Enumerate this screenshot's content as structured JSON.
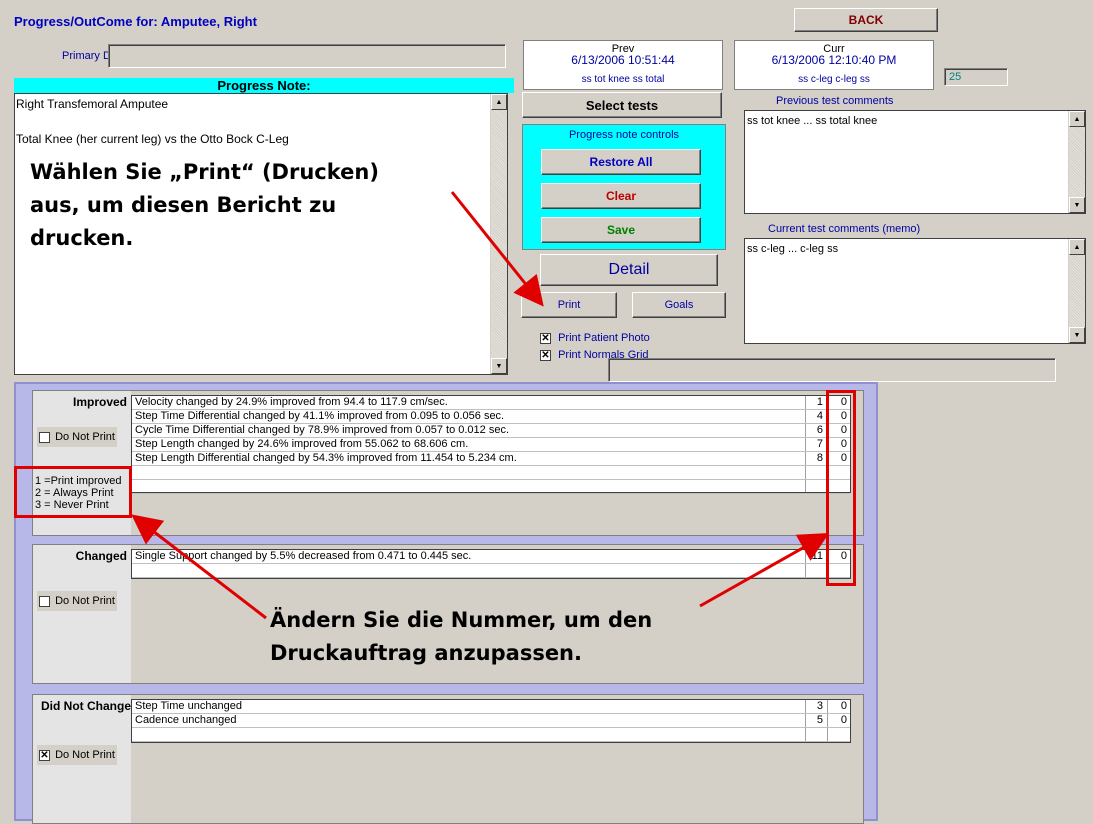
{
  "header": {
    "title": "Progress/OutCome for: Amputee, Right",
    "back_label": "BACK",
    "primary_dr_label": "Primary Dr.",
    "primary_dr_value": ""
  },
  "prev": {
    "label": "Prev",
    "datetime": "6/13/2006 10:51:44",
    "note": "ss tot knee ss total"
  },
  "curr": {
    "label": "Curr",
    "datetime": "6/13/2006 12:10:40 PM",
    "note": "ss c-leg c-leg ss"
  },
  "count_value": "25",
  "progress_note": {
    "header": "Progress Note:",
    "line1": "Right Transfemoral Amputee",
    "line2": "Total Knee (her current leg) vs the Otto Bock C-Leg"
  },
  "controls": {
    "select_tests": "Select tests",
    "panel_title": "Progress note controls",
    "restore_all": "Restore All",
    "clear": "Clear",
    "save": "Save",
    "detail": "Detail",
    "print": "Print",
    "goals": "Goals",
    "print_photo": "Print Patient Photo",
    "print_grid": "Print Normals Grid"
  },
  "comments": {
    "prev_label": "Previous test comments",
    "prev_text": "ss tot knee ...  ss total knee",
    "curr_label": "Current test comments (memo)",
    "curr_text": "ss c-leg ...  c-leg ss"
  },
  "groups": {
    "improved": {
      "label": "Improved",
      "do_not_print": "Do Not Print",
      "legend1": "1 =Print improved",
      "legend2": "2 =  Always Print",
      "legend3": "3 =  Never Print",
      "rows": [
        {
          "text": "Velocity  changed by 24.9% improved from 94.4 to 117.9 cm/sec.",
          "n": "1",
          "v": "0"
        },
        {
          "text": "Step Time Differential  changed by 41.1% improved from 0.095 to 0.056 sec.",
          "n": "4",
          "v": "0"
        },
        {
          "text": "Cycle Time Differential  changed by 78.9% improved from 0.057 to 0.012 sec.",
          "n": "6",
          "v": "0"
        },
        {
          "text": "Step Length  changed by 24.6% improved from 55.062 to 68.606 cm.",
          "n": "7",
          "v": "0"
        },
        {
          "text": "Step Length Differential  changed by 54.3% improved from 11.454 to 5.234 cm.",
          "n": "8",
          "v": "0"
        }
      ]
    },
    "changed": {
      "label": "Changed",
      "do_not_print": "Do Not Print",
      "rows": [
        {
          "text": "Single Support  changed by 5.5% decreased from 0.471 to 0.445 sec.",
          "n": "11",
          "v": "0"
        }
      ]
    },
    "did_not_change": {
      "label": "Did Not Change",
      "do_not_print": "Do Not Print",
      "rows": [
        {
          "text": "Step Time unchanged",
          "n": "3",
          "v": "0"
        },
        {
          "text": "Cadence unchanged",
          "n": "5",
          "v": "0"
        }
      ]
    }
  },
  "callouts": {
    "print_line1": "Wählen Sie „Print“ (Drucken)",
    "print_line2": "aus, um diesen Bericht zu",
    "print_line3": "drucken.",
    "number_line1": "Ändern Sie die Nummer, um den",
    "number_line2": "Druckauftrag anzupassen."
  },
  "colors": {
    "accent_cyan": "#00ffff",
    "title_blue": "#0000c0",
    "callout_red": "#e00000",
    "panel_lavender": "#b8b8e8"
  }
}
